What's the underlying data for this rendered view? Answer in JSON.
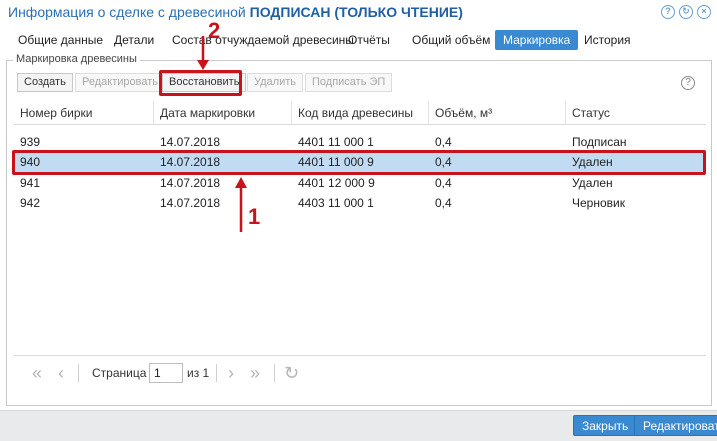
{
  "window": {
    "title_prefix": "Информация о сделке с древесиной",
    "title_status": "ПОДПИСАН (ТОЛЬКО ЧТЕНИЕ)",
    "icons": [
      "help-icon",
      "refresh-icon",
      "close-icon"
    ]
  },
  "tabs": [
    {
      "label": "Общие данные"
    },
    {
      "label": "Детали"
    },
    {
      "label": "Состав отчуждаемой древесины"
    },
    {
      "label": "Отчёты"
    },
    {
      "label": "Общий объём"
    },
    {
      "label": "Маркировка",
      "active": true
    },
    {
      "label": "История"
    }
  ],
  "group": {
    "legend": "Маркировка древесины"
  },
  "toolbar": {
    "create": "Создать",
    "edit": "Редактировать",
    "restore": "Восстановить",
    "delete": "Удалить",
    "sign": "Подписать ЭП"
  },
  "table": {
    "columns": [
      "Номер бирки",
      "Дата маркировки",
      "Код вида древесины",
      "Объём, м³",
      "Статус"
    ],
    "rows": [
      {
        "tag": "939",
        "date": "14.07.2018",
        "code": "4401 11 000 1",
        "volume": "0,4",
        "status": "Подписан"
      },
      {
        "tag": "940",
        "date": "14.07.2018",
        "code": "4401 11 000 9",
        "volume": "0,4",
        "status": "Удален",
        "selected": true
      },
      {
        "tag": "941",
        "date": "14.07.2018",
        "code": "4401 12 000 9",
        "volume": "0,4",
        "status": "Удален"
      },
      {
        "tag": "942",
        "date": "14.07.2018",
        "code": "4403 11 000 1",
        "volume": "0,4",
        "status": "Черновик"
      }
    ]
  },
  "pager": {
    "page_label": "Страница",
    "page_value": "1",
    "of_label": "из 1"
  },
  "footer": {
    "close": "Закрыть",
    "edit": "Редактировать"
  },
  "annotations": {
    "marker_1": "1",
    "marker_2": "2"
  },
  "colors": {
    "accent": "#3a8ad2",
    "selected_row": "#c1dbf2",
    "annotation_red": "#c8131b"
  }
}
